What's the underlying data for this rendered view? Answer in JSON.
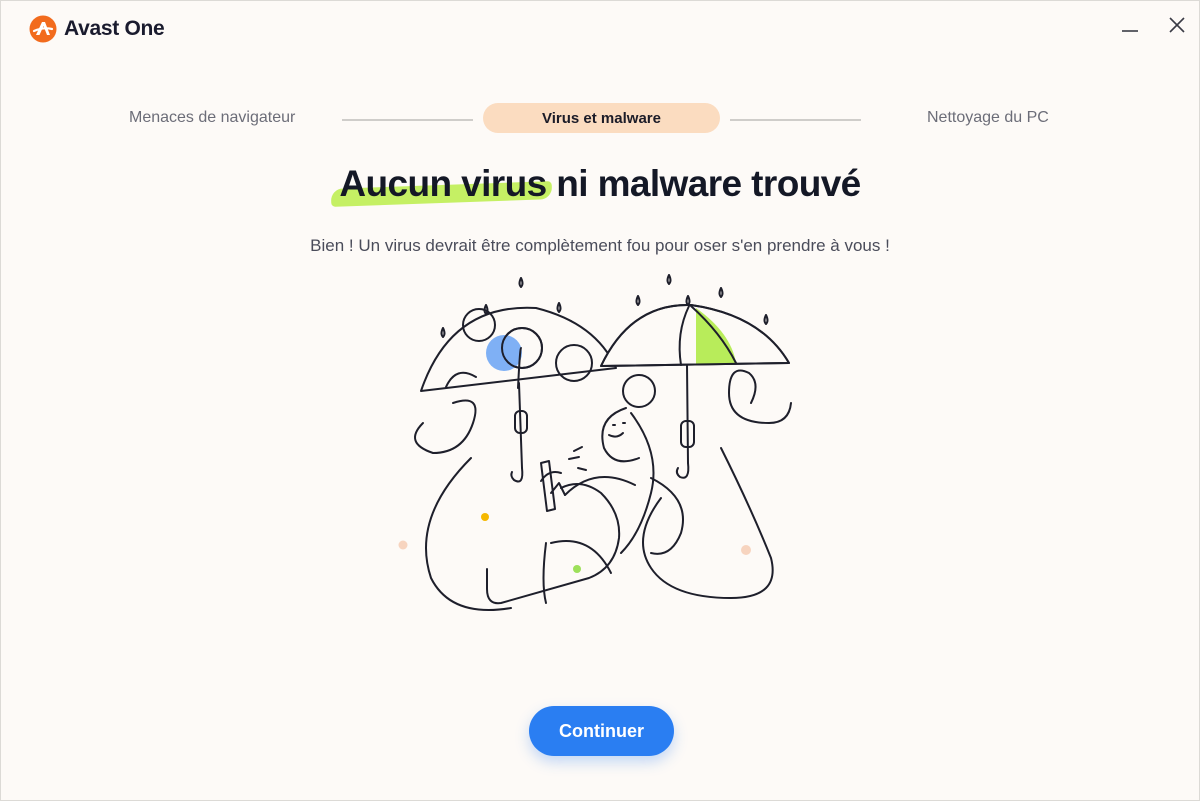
{
  "app": {
    "name": "Avast One",
    "logo_icon": "avast-logo-icon"
  },
  "window_controls": {
    "minimize_icon": "minimize-icon",
    "close_icon": "close-icon"
  },
  "stepper": {
    "steps": [
      {
        "label": "Menaces de navigateur",
        "state": "done"
      },
      {
        "label": "Virus et malware",
        "state": "active"
      },
      {
        "label": "Nettoyage du PC",
        "state": "upcoming"
      }
    ]
  },
  "result": {
    "headline_highlight": "Aucun virus",
    "headline_rest": " ni malware trouvé",
    "subtitle": "Bien ! Un virus devrait être complètement fou pour oser s'en prendre à vous !"
  },
  "illustration": {
    "name": "person-with-umbrellas-illustration"
  },
  "actions": {
    "continue_label": "Continuer"
  },
  "colors": {
    "accent_blue": "#2a7ef2",
    "brand_orange": "#f26b1d",
    "active_step_bg": "#fbdcc0",
    "highlight_green": "#c5f064",
    "background": "#fdfaf7"
  }
}
